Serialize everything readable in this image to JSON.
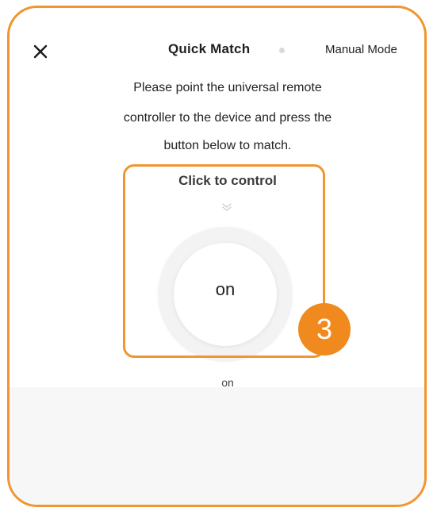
{
  "header": {
    "title": "Quick Match",
    "manual_mode_label": "Manual Mode"
  },
  "instructions": {
    "line1": "Please point the universal remote",
    "line2": "controller to the device and press the",
    "line3": "button below to match."
  },
  "control": {
    "prompt": "Click to control",
    "button_label": "on",
    "caption": "on"
  },
  "annotation": {
    "step_number": "3"
  },
  "colors": {
    "highlight": "#f0962f",
    "badge": "#f08a1e"
  },
  "icons": [
    "close-icon",
    "chevron-down-icon"
  ]
}
